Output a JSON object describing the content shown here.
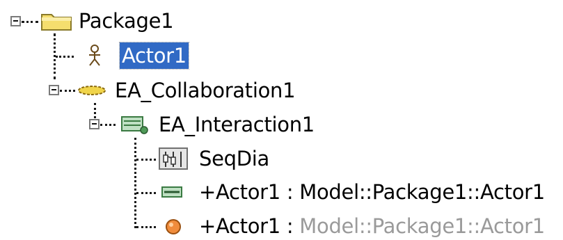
{
  "tree": {
    "nodes": [
      {
        "label": "Package1",
        "icon": "folder-icon",
        "expanded": true,
        "selected": false
      },
      {
        "label": "Actor1",
        "icon": "actor-icon",
        "expanded": false,
        "selected": true
      },
      {
        "label": "EA_Collaboration1",
        "icon": "collaboration-icon",
        "expanded": true,
        "selected": false
      },
      {
        "label": "EA_Interaction1",
        "icon": "interaction-icon",
        "expanded": true,
        "selected": false
      },
      {
        "label": "SeqDia",
        "icon": "sequence-diagram-icon",
        "expanded": false,
        "selected": false
      },
      {
        "label_main": "+Actor1 : Model::Package1::Actor1",
        "icon": "property-icon",
        "selected": false
      },
      {
        "label_main": "+Actor1 : ",
        "label_qualifier": "Model::Package1::Actor1",
        "icon": "lifeline-icon",
        "selected": false
      }
    ]
  },
  "colors": {
    "selection": "#316ac5",
    "folder": "#f5de6e",
    "collaboration": "#f0d44a",
    "interaction": "#4f9a58",
    "lifeline": "#f08c3c",
    "qualifier_text": "#9a9a9a"
  }
}
